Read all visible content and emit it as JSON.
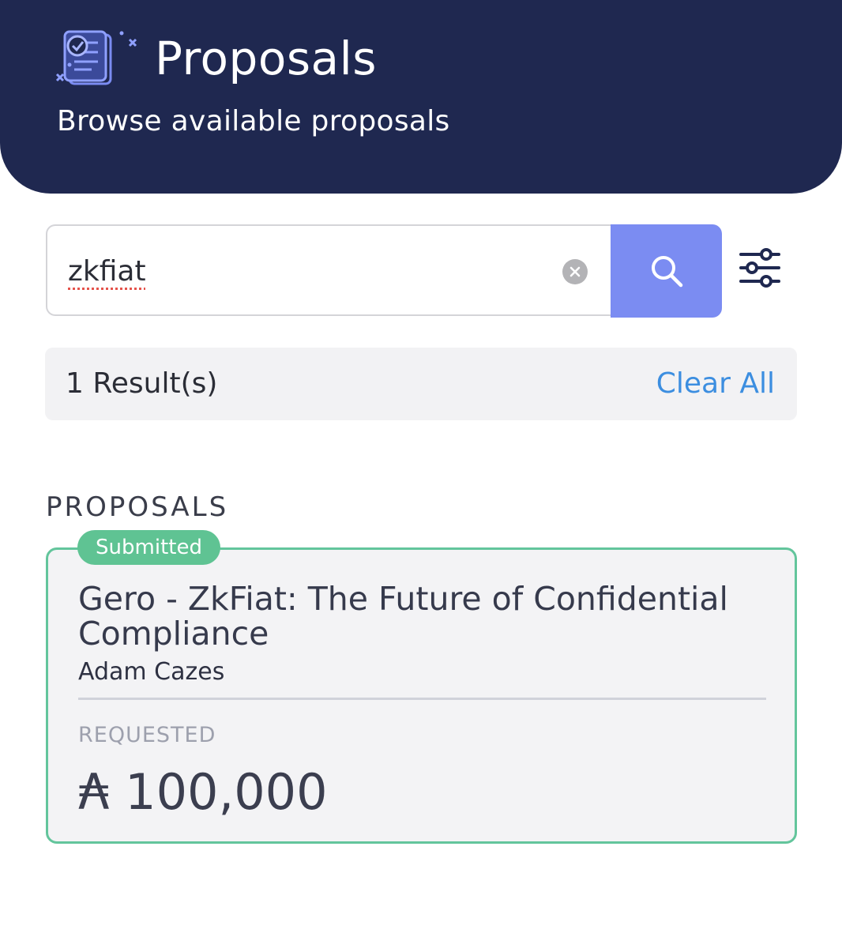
{
  "header": {
    "title": "Proposals",
    "subtitle": "Browse available proposals",
    "icon": "proposals-document-icon"
  },
  "search": {
    "value": "zkfiat",
    "clear_icon": "clear-circle-icon",
    "search_icon": "magnifier-icon",
    "filter_icon": "sliders-filter-icon"
  },
  "results": {
    "count_label": "1 Result(s)",
    "clear_all_label": "Clear All"
  },
  "section": {
    "title": "PROPOSALS"
  },
  "proposals": [
    {
      "status": "Submitted",
      "title": "Gero - ZkFiat: The Future of Confidential Compliance",
      "author": "Adam Cazes",
      "requested_label": "REQUESTED",
      "amount": "₳ 100,000"
    }
  ],
  "colors": {
    "header_bg": "#1f2850",
    "search_button": "#7b8cf2",
    "link": "#3c8ee0",
    "status_submitted": "#5fc393",
    "card_border": "#63c59c"
  }
}
